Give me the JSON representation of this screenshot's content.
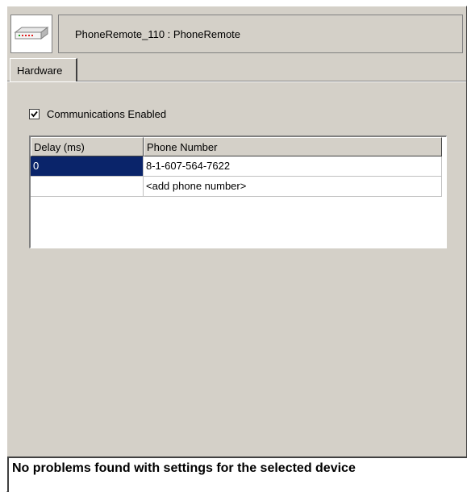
{
  "header": {
    "icon": "network-device-icon",
    "title": "PhoneRemote_110 : PhoneRemote"
  },
  "tabs": [
    {
      "label": "Hardware",
      "active": true
    }
  ],
  "communications": {
    "label": "Communications Enabled",
    "checked": true
  },
  "grid": {
    "columns": [
      "Delay (ms)",
      "Phone Number"
    ],
    "rows": [
      {
        "delay": "0",
        "phone": "8-1-607-564-7622",
        "selected": true
      },
      {
        "delay": "",
        "phone": "<add phone number>",
        "selected": false
      }
    ]
  },
  "status": {
    "message": "No problems found with settings for the selected device"
  },
  "colors": {
    "panel": "#d4d0c8",
    "selection": "#0a246a"
  }
}
